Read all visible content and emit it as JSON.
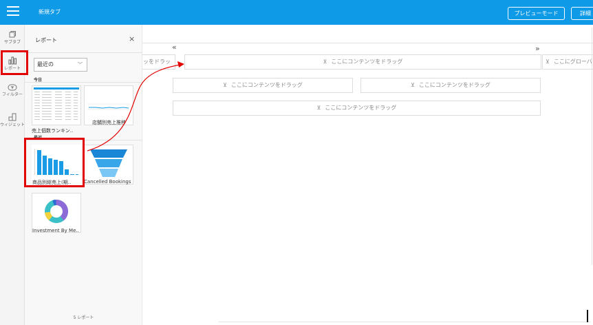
{
  "header": {
    "tab_title": "新規タブ",
    "preview_label": "プレビューモード",
    "detail_label": "詳細"
  },
  "sidebar": {
    "items": [
      {
        "label": "サブタブ",
        "icon": "subtab-icon"
      },
      {
        "label": "レポート",
        "icon": "bar-chart-icon"
      },
      {
        "label": "フィルター",
        "icon": "filter-icon"
      },
      {
        "label": "ウィジェット",
        "icon": "widget-icon"
      }
    ]
  },
  "panel": {
    "title": "レポート",
    "close_glyph": "×",
    "select_value": "最近の",
    "sections": {
      "today": "今日",
      "recent": "最近"
    },
    "cards": [
      {
        "label": "売上個数ランキン..",
        "kind": "table"
      },
      {
        "label": "店舗別売上推移",
        "kind": "line"
      },
      {
        "label": "商品別総売上(期..",
        "kind": "bar"
      },
      {
        "label": "Cancelled Bookings",
        "kind": "funnel"
      },
      {
        "label": "Investment By Me..",
        "kind": "donut"
      }
    ],
    "footer": "5 レポート"
  },
  "canvas": {
    "nav_left": "«",
    "nav_right": "»",
    "zone_partial_left": "ッをドラッ",
    "zone_partial_right": "ここにグローバ",
    "drop_text": "ここにコンテンツをドラッグ",
    "drop_icon": "⊻"
  },
  "colors": {
    "header_bg": "#0e9ae6",
    "highlight": "#e30000",
    "chart_blue": "#1a9be6",
    "donut_purple": "#8c6ad8",
    "donut_teal": "#3cc0c8",
    "donut_yellow": "#f4d23c"
  }
}
